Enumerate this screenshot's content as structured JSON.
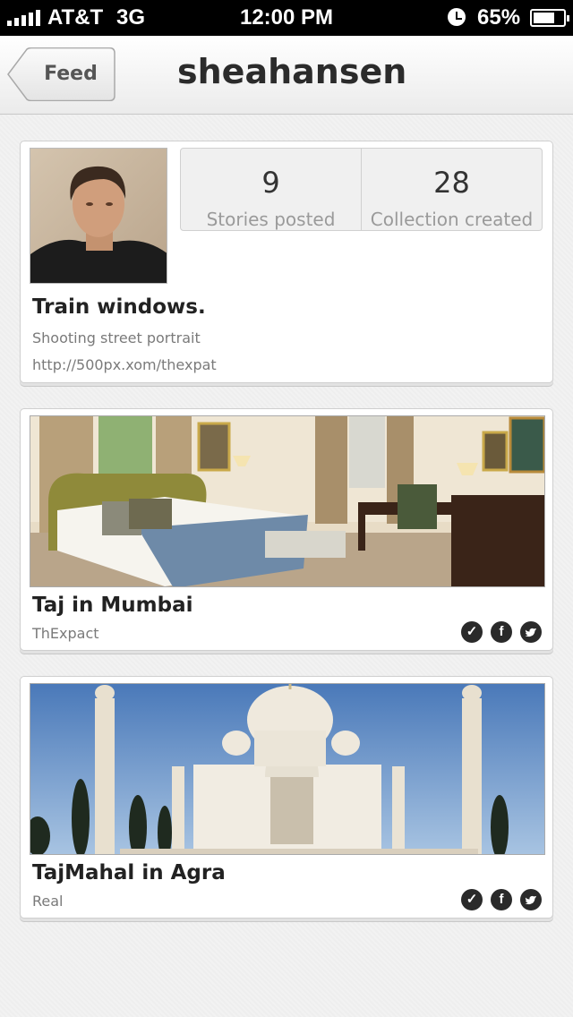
{
  "status_bar": {
    "carrier": "AT&T",
    "network": "3G",
    "time": "12:00 PM",
    "battery": "65%",
    "battery_level": 0.65,
    "icons": [
      "signal-icon",
      "alarm-icon",
      "battery-icon"
    ]
  },
  "nav": {
    "back_label": "Feed",
    "title": "sheahansen"
  },
  "profile": {
    "stats": [
      {
        "value": "9",
        "label": "Stories posted"
      },
      {
        "value": "28",
        "label": "Collection created"
      }
    ],
    "name": "Train windows.",
    "description": "Shooting street portrait",
    "link": "http://500px.xom/thexpat"
  },
  "stories": [
    {
      "title": "Taj in Mumbai",
      "source": "ThExpact",
      "share_icons": [
        "check-icon",
        "facebook-icon",
        "twitter-icon"
      ]
    },
    {
      "title": "TajMahal in Agra",
      "source": "Real",
      "share_icons": [
        "check-icon",
        "facebook-icon",
        "twitter-icon"
      ]
    }
  ],
  "colors": {
    "background": "#f2f2f2",
    "card": "#ffffff",
    "status_bar": "#000000",
    "text_dark": "#222222",
    "text_muted": "#7a7a7a"
  }
}
